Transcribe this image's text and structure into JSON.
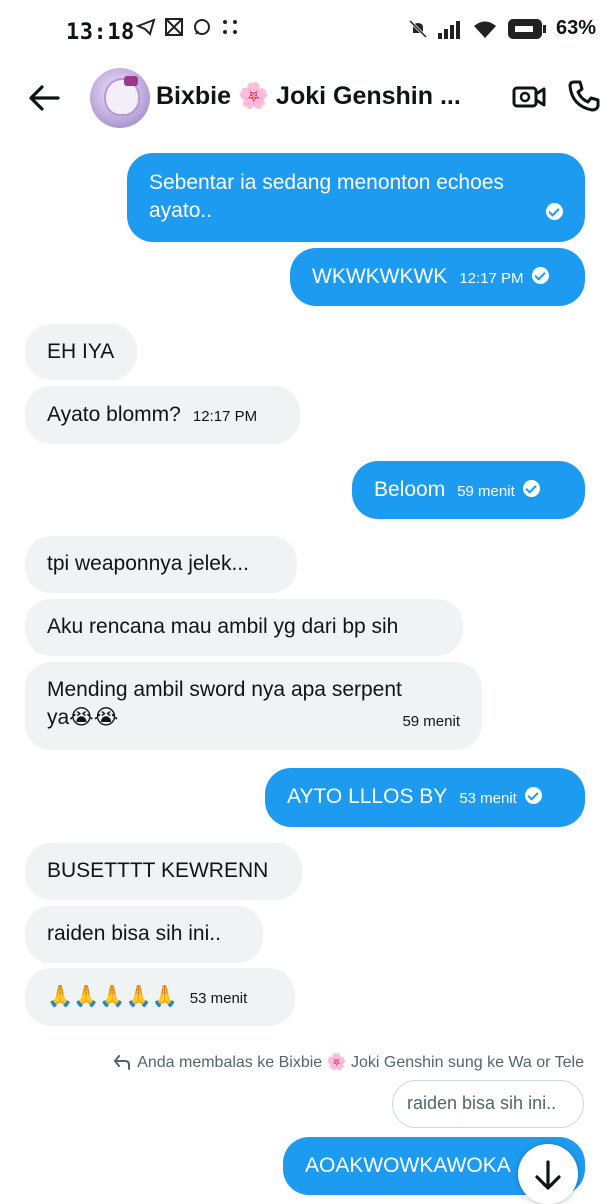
{
  "status_bar": {
    "time": "13:18",
    "battery": "63%"
  },
  "header": {
    "contact_name": "Bixbie 🌸 Joki Genshin ..."
  },
  "messages": [
    {
      "line1": "Sebentar ia sedang menonton echoes",
      "line2": "ayato..",
      "time": ""
    },
    {
      "text": "WKWKWKWK",
      "time": "12:17 PM"
    },
    {
      "text": "EH IYA",
      "time": ""
    },
    {
      "text": "Ayato blomm?",
      "time": "12:17 PM"
    },
    {
      "text": "Beloom",
      "time": "59 menit"
    },
    {
      "text": "tpi weaponnya jelek...",
      "time": ""
    },
    {
      "text": "Aku rencana mau ambil yg dari bp sih",
      "time": ""
    },
    {
      "line1": "Mending ambil sword nya apa serpent",
      "line2": "ya😭😭",
      "time": "59 menit"
    },
    {
      "text": "AYTO LLLOS BY",
      "time": "53 menit"
    },
    {
      "text": "BUSETTTT KEWRENN",
      "time": ""
    },
    {
      "text": "raiden bisa sih ini..",
      "time": ""
    },
    {
      "text": "🙏🙏🙏🙏🙏",
      "time": "53 menit"
    }
  ],
  "reply": {
    "note": "Anda membalas ke Bixbie 🌸 Joki Genshin sung ke Wa or Tele",
    "quoted": "raiden bisa sih ini..",
    "text": "AOAKWOWKAWOKA"
  },
  "colors": {
    "accent": "#1d9bf0",
    "incoming": "#eff3f4"
  }
}
